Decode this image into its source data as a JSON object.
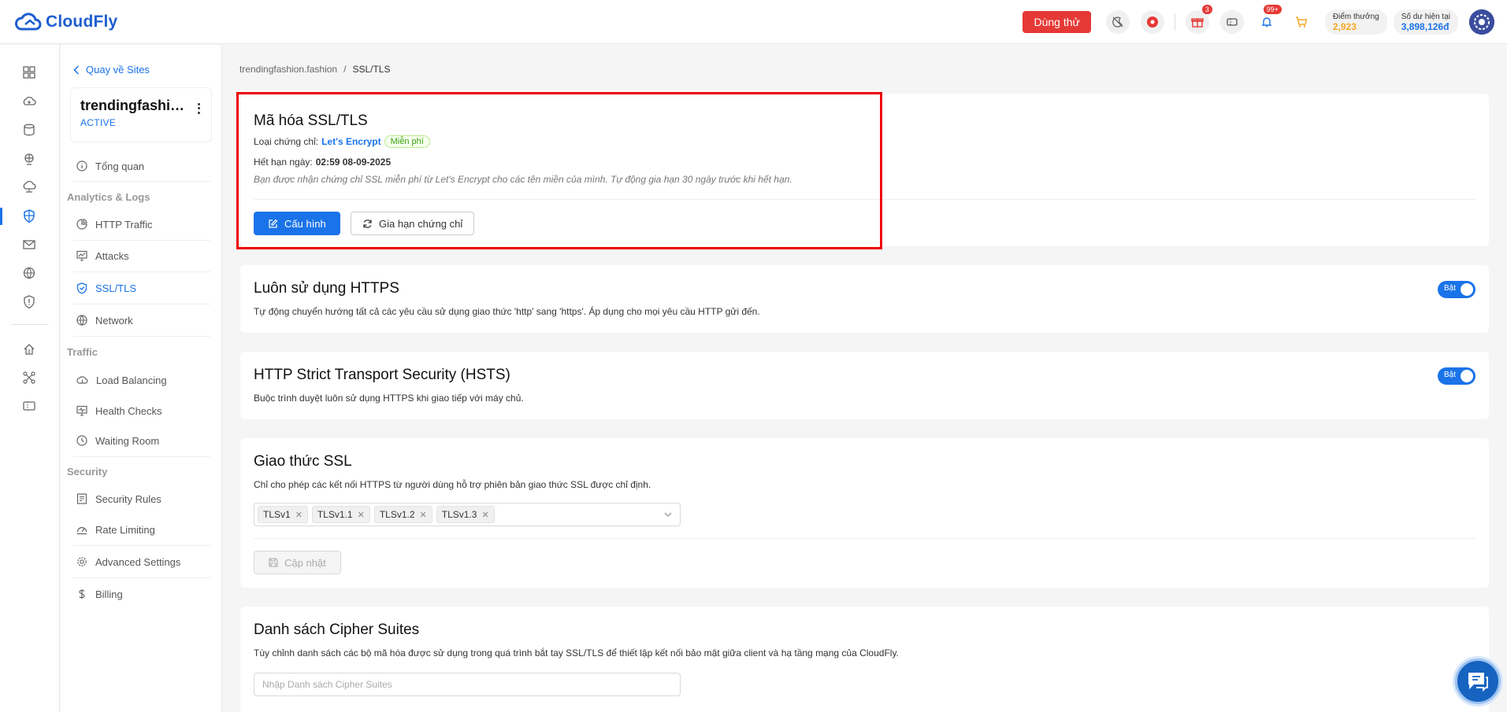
{
  "header": {
    "brand": "CloudFly",
    "trial_label": "Dùng thử",
    "gift_count": "3",
    "notif_count": "99+",
    "points_label": "Điểm thưởng",
    "points_value": "2,923",
    "balance_label": "Số dư hiện tại",
    "balance_value": "3,898,126đ",
    "icons": [
      "moon-off-icon",
      "record-icon",
      "gift-icon",
      "ticket-icon",
      "bell-icon",
      "cart-icon"
    ]
  },
  "nav": {
    "back": "Quay về Sites",
    "site_name": "trendingfashion.fashion",
    "site_status": "ACTIVE",
    "overview": "Tổng quan",
    "group_analytics": "Analytics & Logs",
    "http_traffic": "HTTP Traffic",
    "attacks": "Attacks",
    "ssl": "SSL/TLS",
    "network": "Network",
    "group_traffic": "Traffic",
    "load_balancing": "Load Balancing",
    "health_checks": "Health Checks",
    "waiting_room": "Waiting Room",
    "group_security": "Security",
    "security_rules": "Security Rules",
    "rate_limiting": "Rate Limiting",
    "advanced_settings": "Advanced Settings",
    "billing": "Billing"
  },
  "breadcrumb": {
    "site": "trendingfashion.fashion",
    "sep": "/",
    "current": "SSL/TLS"
  },
  "ssl_card": {
    "title": "Mã hóa SSL/TLS",
    "cert_type_label": "Loại chứng chỉ:",
    "cert_type_value": "Let's Encrypt",
    "cert_tag": "Miễn phí",
    "expiry_label": "Hết hạn ngày:",
    "expiry_value": "02:59 08-09-2025",
    "note": "Bạn được nhận chứng chỉ SSL miễn phí từ Let's Encrypt cho các tên miền của mình. Tự động gia hạn 30 ngày trước khi hết hạn.",
    "configure_btn": "Cấu hình",
    "renew_btn": "Gia hạn chứng chỉ"
  },
  "https_card": {
    "title": "Luôn sử dụng HTTPS",
    "desc": "Tự động chuyển hướng tất cả các yêu cầu sử dụng giao thức 'http' sang 'https'. Áp dụng cho mọi yêu cầu HTTP gửi đến.",
    "toggle_label": "Bật",
    "enabled": true
  },
  "hsts_card": {
    "title": "HTTP Strict Transport Security (HSTS)",
    "desc": "Buộc trình duyệt luôn sử dụng HTTPS khi giao tiếp với máy chủ.",
    "toggle_label": "Bật",
    "enabled": true
  },
  "protocol_card": {
    "title": "Giao thức SSL",
    "desc": "Chỉ cho phép các kết nối HTTPS từ người dùng hỗ trợ phiên bản giao thức SSL được chỉ định.",
    "tags": [
      "TLSv1",
      "TLSv1.1",
      "TLSv1.2",
      "TLSv1.3"
    ],
    "update_btn": "Cập nhật"
  },
  "cipher_card": {
    "title": "Danh sách Cipher Suites",
    "desc": "Tùy chỉnh danh sách các bộ mã hóa được sử dụng trong quá trình bắt tay SSL/TLS để thiết lập kết nối bảo mật giữa client và hạ tầng mạng của CloudFly.",
    "placeholder": "Nhập Danh sách Cipher Suites"
  },
  "colors": {
    "primary": "#1a73e8",
    "brand": "#1e5ecf",
    "danger": "#e53935",
    "success_tag": "#52c41a"
  }
}
